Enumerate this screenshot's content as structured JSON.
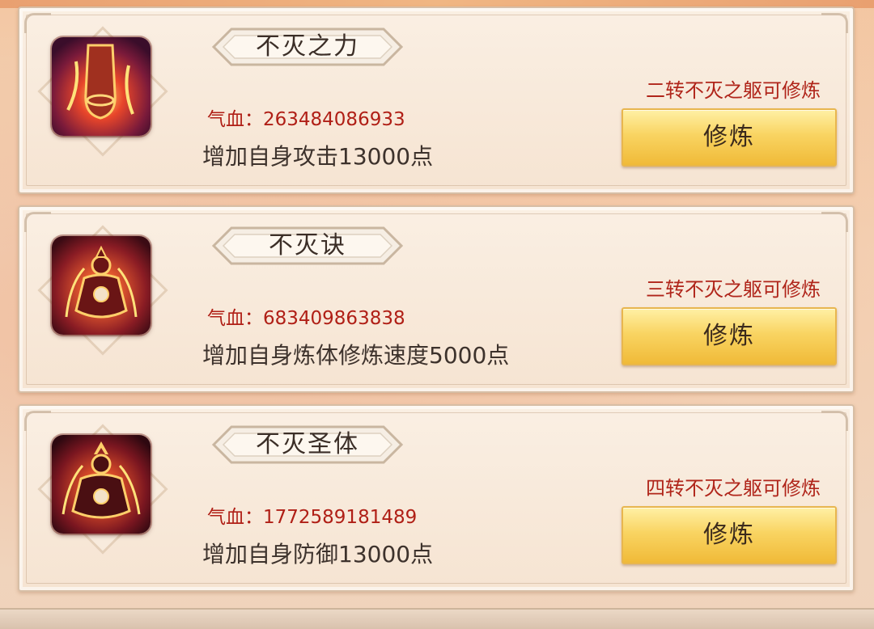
{
  "skills": [
    {
      "name": "不灭之力",
      "hp": "气血：263484086933",
      "desc": "增加自身攻击13000点",
      "requirement": "二转不灭之躯可修炼",
      "button": "修炼",
      "icon": "flaming-fist-icon"
    },
    {
      "name": "不灭诀",
      "hp": "气血：683409863838",
      "desc": "增加自身炼体修炼速度5000点",
      "requirement": "三转不灭之躯可修炼",
      "button": "修炼",
      "icon": "meditating-figure-icon"
    },
    {
      "name": "不灭圣体",
      "hp": "气血：1772589181489",
      "desc": "增加自身防御13000点",
      "requirement": "四转不灭之躯可修炼",
      "button": "修炼",
      "icon": "crowned-meditating-figure-icon"
    }
  ],
  "colors": {
    "hp_text": "#b01f16",
    "requirement_text": "#b0251a",
    "button_gold": "#f9d462"
  }
}
